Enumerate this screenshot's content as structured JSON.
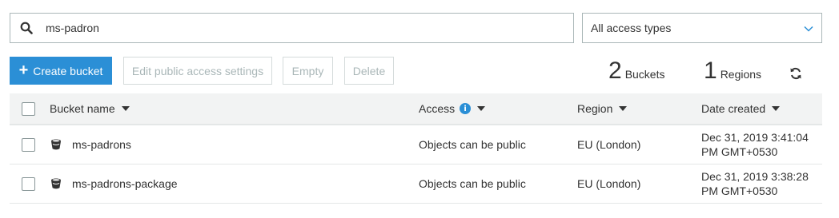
{
  "search": {
    "value": "ms-padron",
    "placeholder": ""
  },
  "access_filter": {
    "selected": "All access types"
  },
  "toolbar": {
    "create_label": "Create bucket",
    "edit_label": "Edit public access settings",
    "empty_label": "Empty",
    "delete_label": "Delete"
  },
  "stats": {
    "buckets_count": "2",
    "buckets_label": "Buckets",
    "regions_count": "1",
    "regions_label": "Regions"
  },
  "table": {
    "headers": {
      "name": "Bucket name",
      "access": "Access",
      "region": "Region",
      "date": "Date created"
    },
    "rows": [
      {
        "name": "ms-padrons",
        "access": "Objects can be public",
        "region": "EU (London)",
        "date": "Dec 31, 2019 3:41:04 PM GMT+0530"
      },
      {
        "name": "ms-padrons-package",
        "access": "Objects can be public",
        "region": "EU (London)",
        "date": "Dec 31, 2019 3:38:28 PM GMT+0530"
      }
    ]
  },
  "icons": {
    "search": "search-icon",
    "chevron": "chevron-down-icon",
    "plus": "plus-icon",
    "refresh": "refresh-icon",
    "info": "info-icon",
    "bucket": "bucket-icon"
  },
  "colors": {
    "primary": "#2b8fd6",
    "header_bg": "#f2f3f3"
  }
}
